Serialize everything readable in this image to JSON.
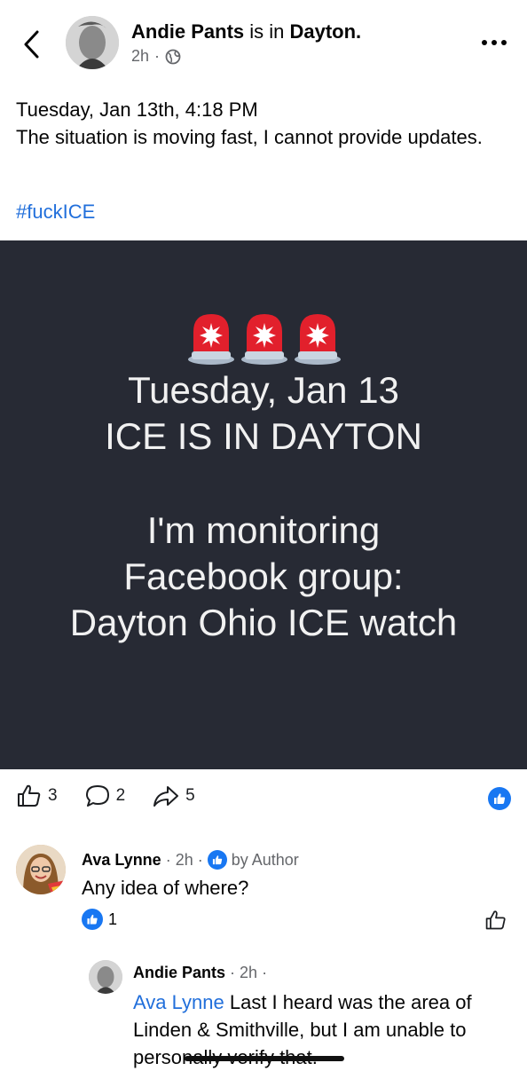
{
  "header": {
    "author": "Andie Pants",
    "connector": " is in ",
    "place": "Dayton.",
    "time": "2h",
    "dot": "·"
  },
  "post": {
    "line1": "Tuesday, Jan 13th, 4:18 PM",
    "line2": "The situation is moving fast, I cannot provide updates.",
    "hashtag": "#fuckICE"
  },
  "image": {
    "line1": "Tuesday, Jan 13",
    "line2": "ICE IS IN DAYTON",
    "line3": "I'm monitoring",
    "line4": "Facebook group:",
    "line5": "Dayton Ohio ICE watch",
    "background": "#272a34"
  },
  "actions": {
    "likes": "3",
    "comments": "2",
    "shares": "5"
  },
  "comment": {
    "name": "Ava Lynne",
    "time": "2h",
    "liked_by": "by Author",
    "text": "Any idea of where?",
    "reactions": "1"
  },
  "reply": {
    "name": "Andie Pants",
    "time": "2h",
    "mention": "Ava Lynne",
    "text": " Last I heard was the area of Linden & Smithville, but I am unable to personally verify that."
  },
  "colors": {
    "link": "#216fdb",
    "like_blue": "#1877f2",
    "secondary_text": "#65676b"
  }
}
